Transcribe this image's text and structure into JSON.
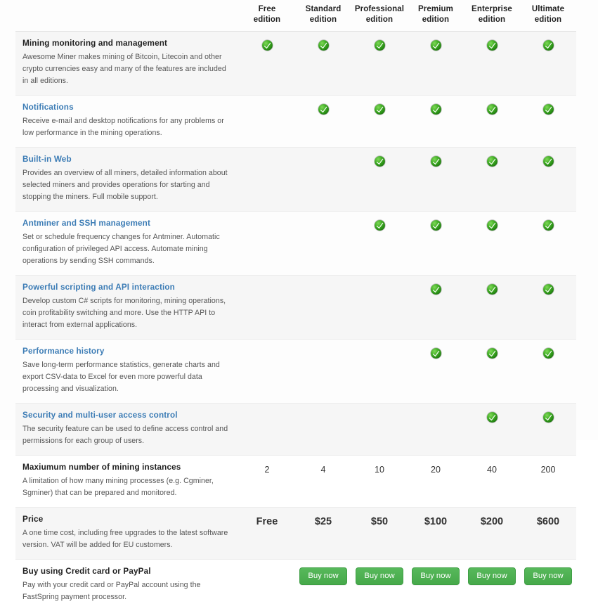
{
  "colors": {
    "accent_link": "#3c7cb5",
    "check_green": "#2e9e2e",
    "button_green": "#4caf50",
    "row_alt_bg": "#f6f6f6",
    "page_bg": "#fdfdfd"
  },
  "table": {
    "feature_column_header": "",
    "editions": [
      {
        "name": "Free",
        "line2": "edition"
      },
      {
        "name": "Standard",
        "line2": "edition"
      },
      {
        "name": "Professional",
        "line2": "edition"
      },
      {
        "name": "Premium",
        "line2": "edition"
      },
      {
        "name": "Enterprise",
        "line2": "edition"
      },
      {
        "name": "Ultimate",
        "line2": "edition"
      }
    ],
    "rows": [
      {
        "title": "Mining monitoring and management",
        "title_style": "plain",
        "description": "Awesome Miner makes mining of Bitcoin, Litecoin and other crypto currencies easy and many of the features are included in all editions.",
        "cells": [
          "check",
          "check",
          "check",
          "check",
          "check",
          "check"
        ]
      },
      {
        "title": "Notifications",
        "title_style": "link",
        "description": "Receive e-mail and desktop notifications for any problems or low performance in the mining operations.",
        "cells": [
          "",
          "check",
          "check",
          "check",
          "check",
          "check"
        ]
      },
      {
        "title": "Built-in Web",
        "title_style": "link",
        "description": "Provides an overview of all miners, detailed information about selected miners and provides operations for starting and stopping the miners. Full mobile support.",
        "cells": [
          "",
          "",
          "check",
          "check",
          "check",
          "check"
        ]
      },
      {
        "title": "Antminer and SSH management",
        "title_style": "link",
        "description": "Set or schedule frequency changes for Antminer. Automatic configuration of privileged API access. Automate mining operations by sending SSH commands.",
        "cells": [
          "",
          "",
          "check",
          "check",
          "check",
          "check"
        ]
      },
      {
        "title": "Powerful scripting and API interaction",
        "title_style": "link",
        "description": "Develop custom C# scripts for monitoring, mining operations, coin profitability switching and more. Use the HTTP API to interact from external applications.",
        "cells": [
          "",
          "",
          "",
          "check",
          "check",
          "check"
        ]
      },
      {
        "title": "Performance history",
        "title_style": "link",
        "description": "Save long-term performance statistics, generate charts and export CSV-data to Excel for even more powerful data processing and visualization.",
        "cells": [
          "",
          "",
          "",
          "check",
          "check",
          "check"
        ]
      },
      {
        "title": "Security and multi-user access control",
        "title_style": "link",
        "description": "The security feature can be used to define access control and permissions for each group of users.",
        "cells": [
          "",
          "",
          "",
          "",
          "check",
          "check"
        ]
      },
      {
        "title": "Maxiumum number of mining instances",
        "title_style": "plain",
        "description": "A limitation of how many mining processes (e.g. Cgminer, Sgminer) that can be prepared and monitored.",
        "cells": [
          "2",
          "4",
          "10",
          "20",
          "40",
          "200"
        ]
      },
      {
        "title": "Price",
        "title_style": "plain",
        "description": "A one time cost, including free upgrades to the latest software version. VAT will be added for EU customers.",
        "cells": [
          "Free",
          "$25",
          "$50",
          "$100",
          "$200",
          "$600"
        ],
        "bold_values": true
      },
      {
        "title": "Buy using Credit card or PayPal",
        "title_style": "plain",
        "description": "Pay with your credit card or PayPal account using the FastSpring payment processor.",
        "cells": [
          "",
          "button",
          "button",
          "button",
          "button",
          "button"
        ],
        "button_label": "Buy now"
      }
    ]
  },
  "icons": {
    "check": "check-circle-icon"
  }
}
